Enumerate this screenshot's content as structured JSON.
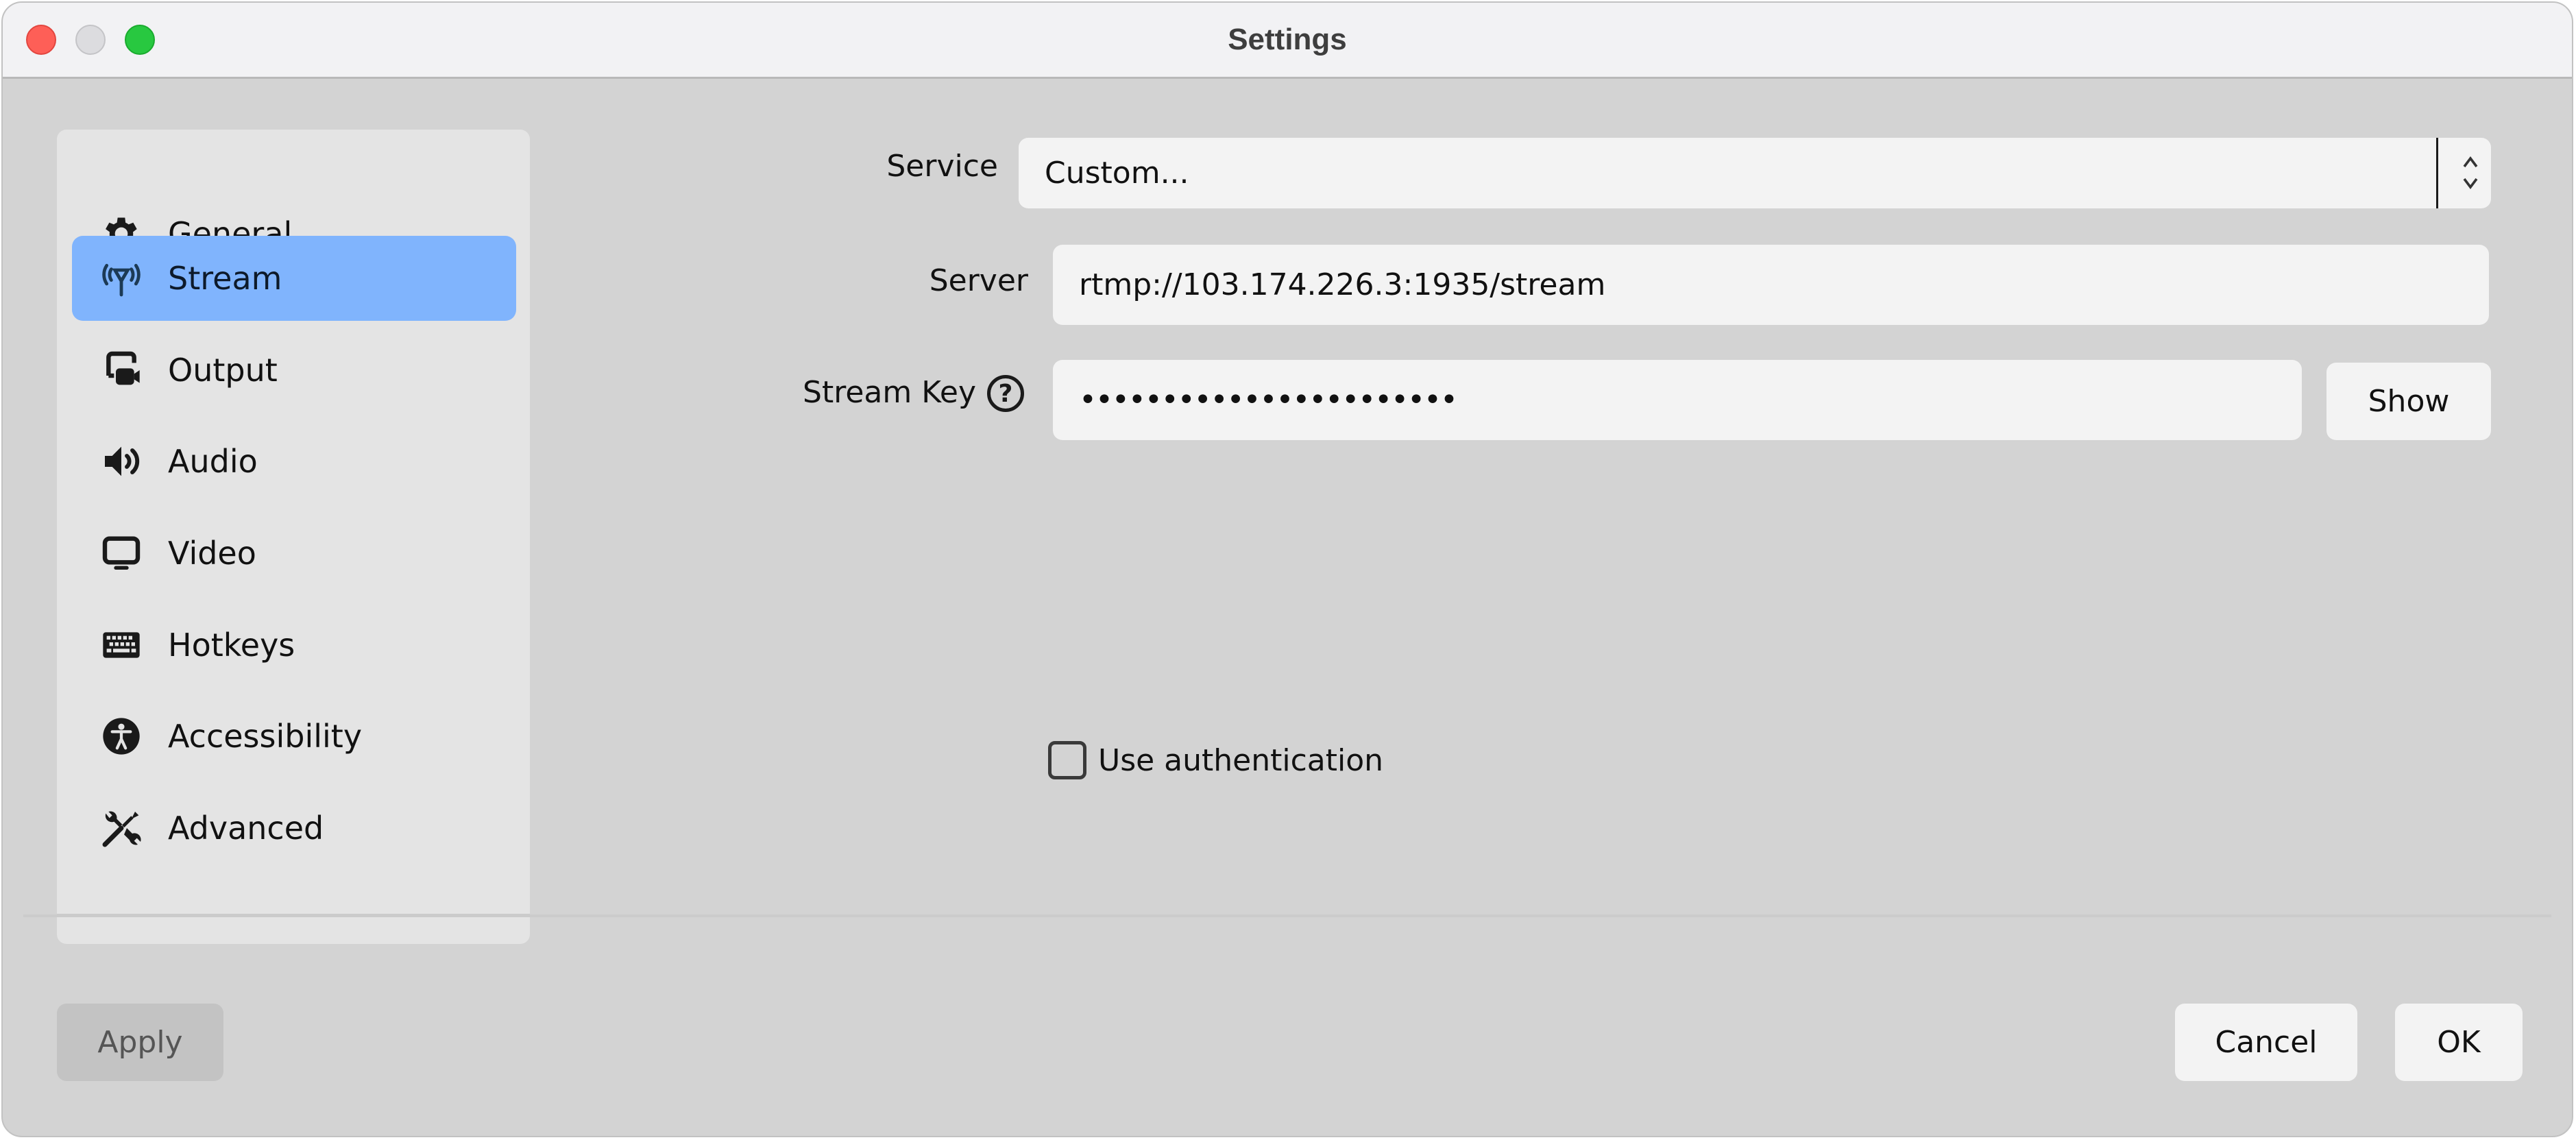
{
  "window": {
    "title": "Settings",
    "controls": [
      "close",
      "minimize",
      "maximize"
    ]
  },
  "sidebar": {
    "active_index": 1,
    "items": [
      {
        "label": "General",
        "icon": "gear-icon"
      },
      {
        "label": "Stream",
        "icon": "antenna-icon"
      },
      {
        "label": "Output",
        "icon": "output-camera-icon"
      },
      {
        "label": "Audio",
        "icon": "speaker-icon"
      },
      {
        "label": "Video",
        "icon": "monitor-icon"
      },
      {
        "label": "Hotkeys",
        "icon": "keyboard-icon"
      },
      {
        "label": "Accessibility",
        "icon": "accessibility-icon"
      },
      {
        "label": "Advanced",
        "icon": "tools-icon"
      }
    ]
  },
  "form": {
    "service": {
      "label": "Service",
      "value": "Custom..."
    },
    "server": {
      "label": "Server",
      "value": "rtmp://103.174.226.3:1935/stream"
    },
    "stream_key": {
      "label": "Stream Key",
      "value": "•••••••••••••••••••••••",
      "help": "?",
      "show_label": "Show"
    },
    "use_authentication": {
      "label": "Use authentication",
      "checked": false
    }
  },
  "footer": {
    "apply_label": "Apply",
    "cancel_label": "Cancel",
    "ok_label": "OK"
  },
  "colors": {
    "accent_selected": "#80b4fd",
    "window_bg": "#d3d3d3",
    "sidebar_bg": "#e4e4e4",
    "field_bg": "#f3f3f3",
    "close": "#fe5f57",
    "maximize": "#28c840"
  }
}
